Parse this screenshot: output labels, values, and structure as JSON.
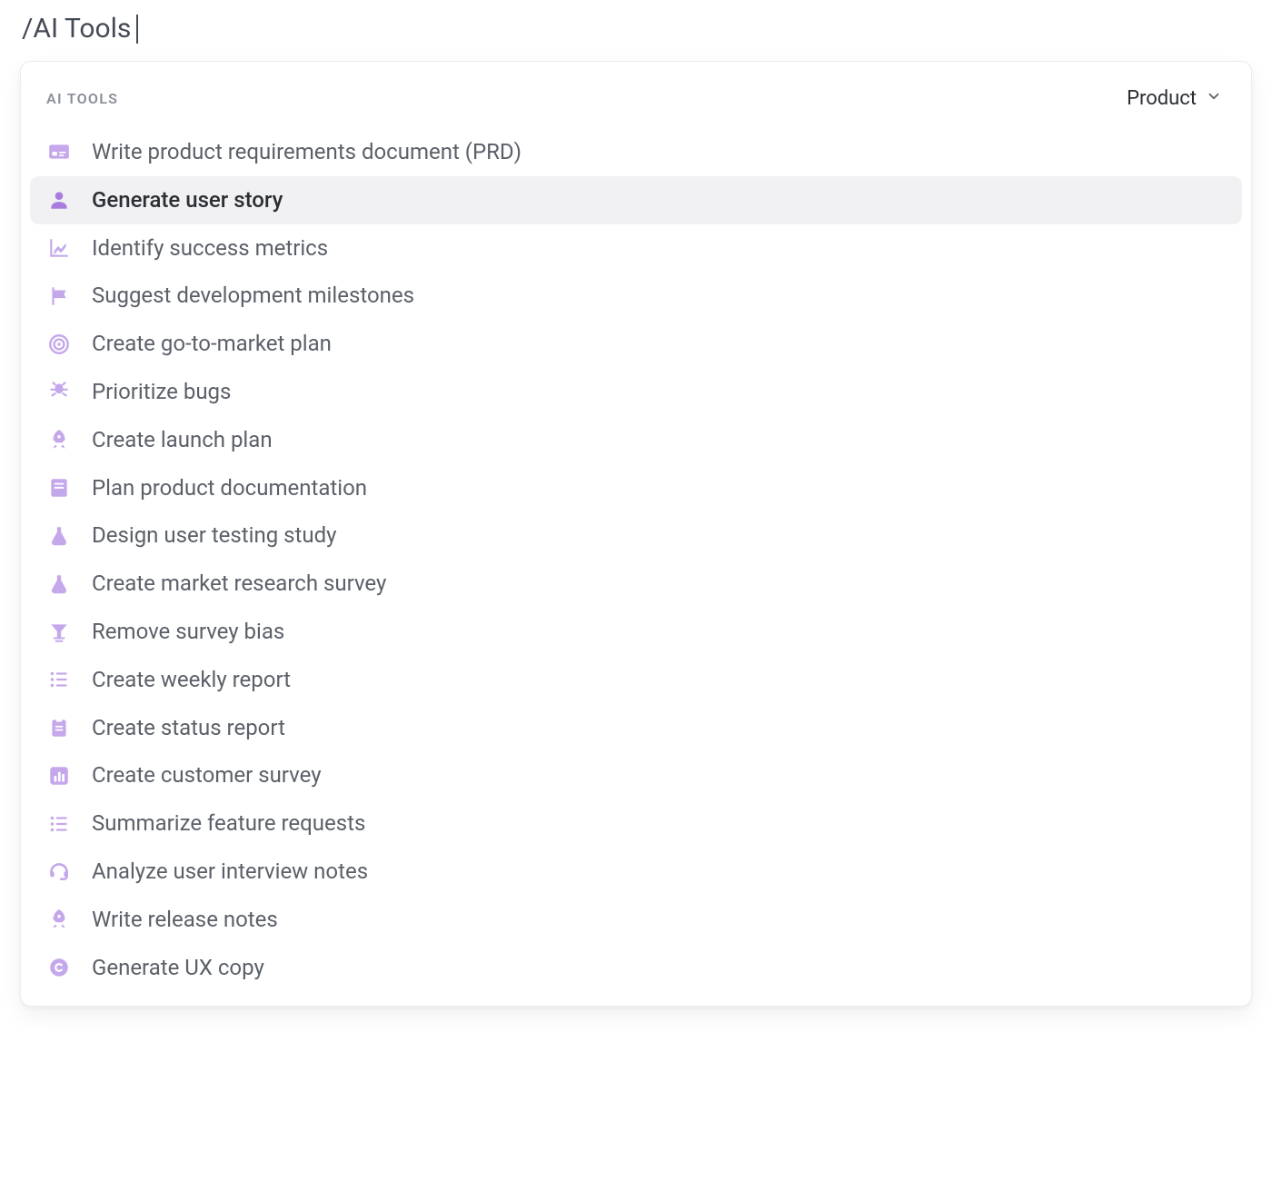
{
  "command_input": "/AI Tools",
  "panel": {
    "title": "AI TOOLS",
    "filter": {
      "label": "Product"
    }
  },
  "items": [
    {
      "icon": "id-card-icon",
      "label": "Write product requirements document (PRD)",
      "selected": false
    },
    {
      "icon": "user-icon",
      "label": "Generate user story",
      "selected": true
    },
    {
      "icon": "chart-line-icon",
      "label": "Identify success metrics",
      "selected": false
    },
    {
      "icon": "flag-icon",
      "label": "Suggest development milestones",
      "selected": false
    },
    {
      "icon": "target-icon",
      "label": "Create go-to-market plan",
      "selected": false
    },
    {
      "icon": "bug-icon",
      "label": "Prioritize bugs",
      "selected": false
    },
    {
      "icon": "rocket-icon",
      "label": "Create launch plan",
      "selected": false
    },
    {
      "icon": "book-icon",
      "label": "Plan product documentation",
      "selected": false
    },
    {
      "icon": "flask-icon",
      "label": "Design user testing study",
      "selected": false
    },
    {
      "icon": "flask-icon",
      "label": "Create market research survey",
      "selected": false
    },
    {
      "icon": "filter-icon",
      "label": "Remove survey bias",
      "selected": false
    },
    {
      "icon": "list-icon",
      "label": "Create weekly report",
      "selected": false
    },
    {
      "icon": "clipboard-icon",
      "label": "Create status report",
      "selected": false
    },
    {
      "icon": "bar-chart-icon",
      "label": "Create customer survey",
      "selected": false
    },
    {
      "icon": "list-icon",
      "label": "Summarize feature requests",
      "selected": false
    },
    {
      "icon": "headset-icon",
      "label": "Analyze user interview notes",
      "selected": false
    },
    {
      "icon": "rocket-icon",
      "label": "Write release notes",
      "selected": false
    },
    {
      "icon": "copyright-icon",
      "label": "Generate UX copy",
      "selected": false
    }
  ]
}
